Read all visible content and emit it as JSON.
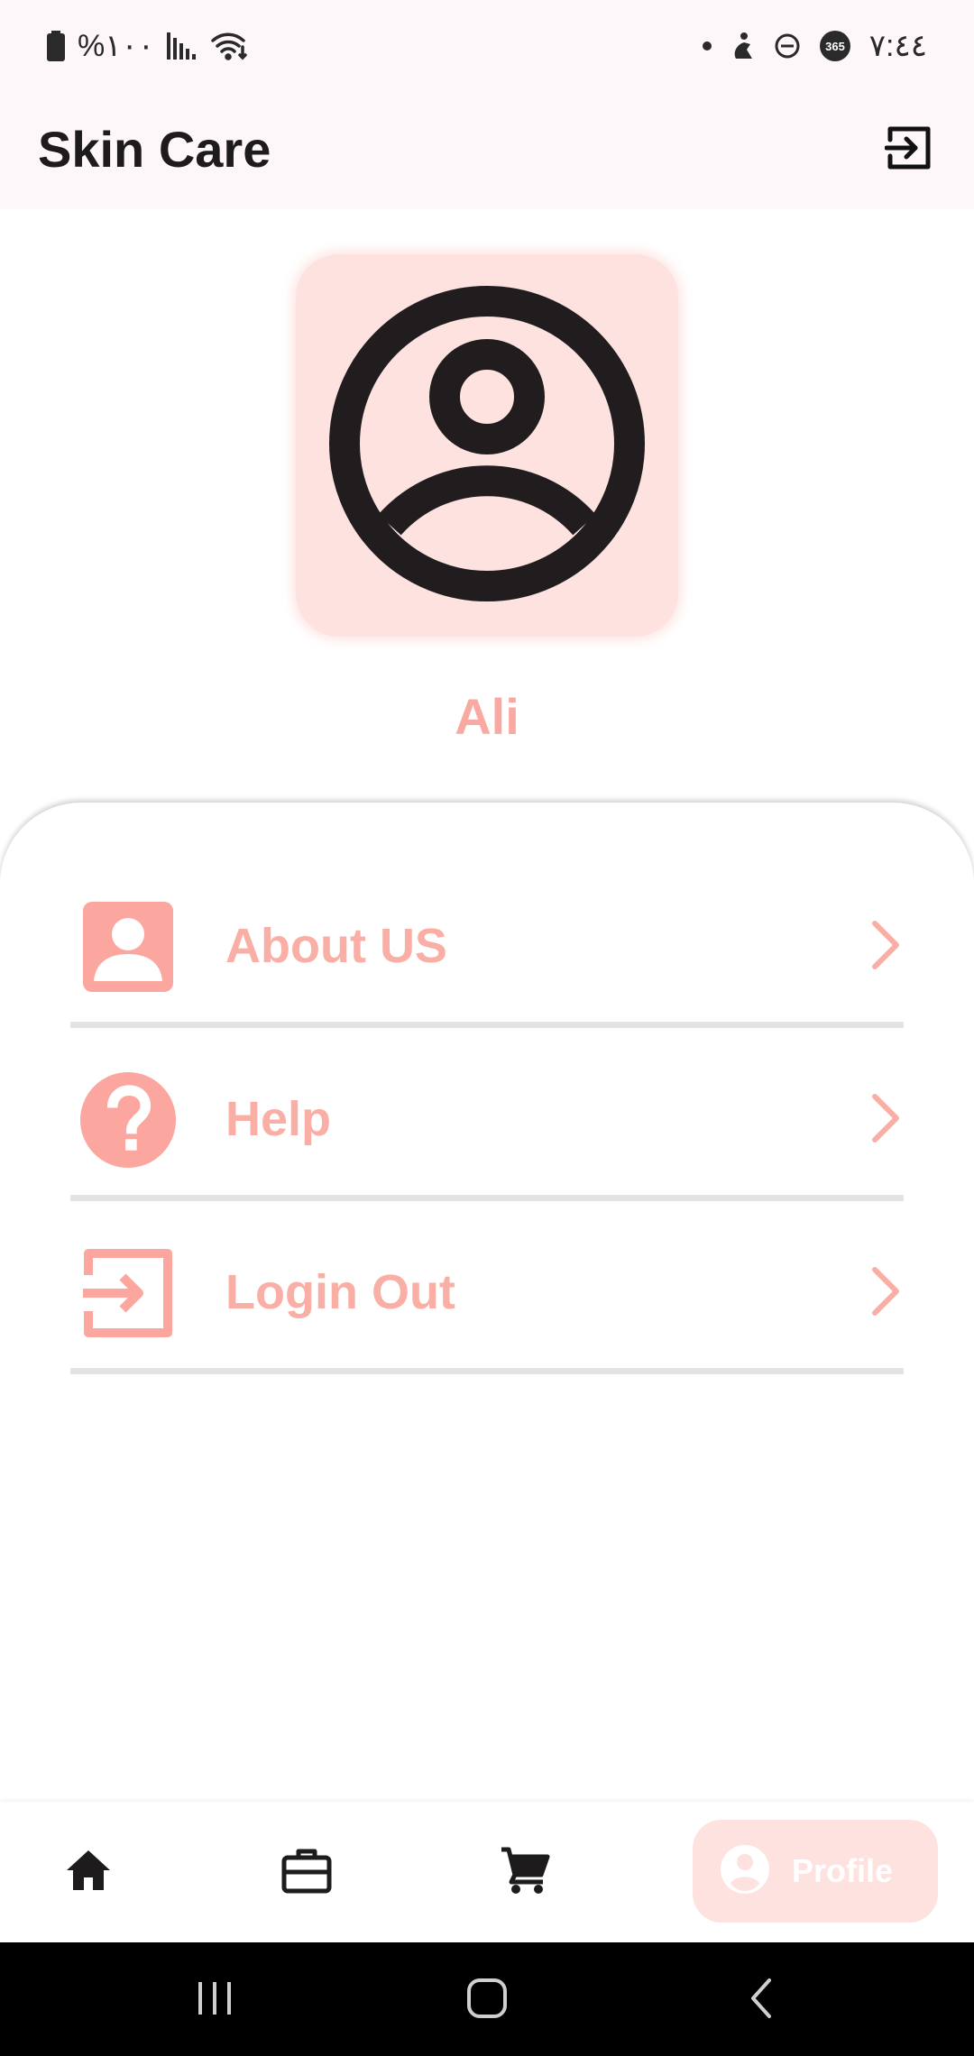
{
  "status_bar": {
    "battery_text": "%١٠٠",
    "time": "٧:٤٤",
    "icons": [
      "battery-icon",
      "signal-icon",
      "wifi-icon",
      "dot-icon",
      "accessibility-icon",
      "dnd-icon",
      "app-365-icon"
    ]
  },
  "app_bar": {
    "title": "Skin Care",
    "exit_icon": "exit-icon"
  },
  "profile": {
    "avatar_icon": "account-circle-icon",
    "name": "Ali"
  },
  "menu": {
    "items": [
      {
        "label": "About US",
        "icon": "person-icon"
      },
      {
        "label": "Help",
        "icon": "help-icon"
      },
      {
        "label": "Login Out",
        "icon": "logout-icon"
      }
    ]
  },
  "bottom_nav": {
    "items": [
      {
        "icon": "home-icon"
      },
      {
        "icon": "briefcase-icon"
      },
      {
        "icon": "cart-icon"
      }
    ],
    "active": {
      "label": "Profile",
      "icon": "profile-icon"
    }
  },
  "system_nav": {
    "icons": [
      "recent-apps-icon",
      "home-circle-icon",
      "back-icon"
    ]
  },
  "colors": {
    "accent": "#f9aea6",
    "accent_light": "#fde2df",
    "app_bar_bg": "#fdf7f9",
    "divider": "#e4e3e3"
  }
}
